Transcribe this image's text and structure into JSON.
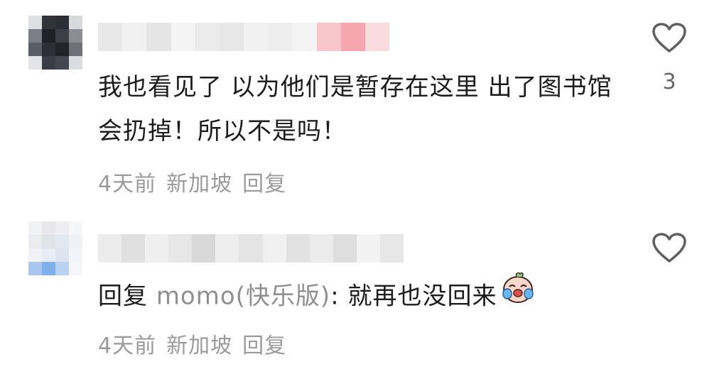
{
  "comments": [
    {
      "text": "我也看见了 以为他们是暂存在这里 出了图书馆会扔掉！所以不是吗！",
      "time": "4天前",
      "location": "新加坡",
      "reply_label": "回复",
      "like_count": "3",
      "avatar_colors": [
        "#dfe0e3",
        "#30333a",
        "#2a2d34",
        "#d9dadd",
        "#7a7d85",
        "#1e2128",
        "#3b3f48",
        "#8b8e95",
        "#5a5d66",
        "#2d3038",
        "#20232a",
        "#6e7179",
        "#e4e5e8",
        "#3a3d45",
        "#44474f",
        "#dcdde0"
      ],
      "username_colors": [
        "#e8e8e8",
        "#f1f1f1",
        "#e5e5e5",
        "#f4f4f4",
        "#ebebeb",
        "#e7e7e7",
        "#f0f0f0",
        "#ededed",
        "#f3f3f3",
        "#f7c6cb",
        "#f5a5ae",
        "#f9dadd"
      ]
    },
    {
      "reply_prefix": "回复",
      "reply_to": "momo(快乐版)",
      "text": ": 就再也没回来",
      "emoji": "crying-face",
      "time": "4天前",
      "location": "新加坡",
      "reply_label": "回复",
      "like_count": "",
      "avatar_colors": [
        "#f1f2f4",
        "#e6e8ec",
        "#eceef1",
        "#f5f6f8",
        "#e9ebef",
        "#dfe3ea",
        "#e3e7ee",
        "#eff1f4",
        "#f0f2f5",
        "#e8ecf3",
        "#dde4ef",
        "#f2f4f7",
        "#a9c6ef",
        "#7fb0ec",
        "#b9d2f3",
        "#f4f6f9"
      ],
      "username_colors": [
        "#ececec",
        "#e0e0e0",
        "#efefef",
        "#e6e6e6",
        "#d9d9d9",
        "#eeeeee",
        "#e4e4e4",
        "#f0f0f0",
        "#e2e2e2",
        "#ebebeb",
        "#dedede",
        "#f2f2f2",
        "#e7e7e7"
      ]
    }
  ],
  "icons": {
    "like": "heart-outline-icon",
    "emoji": "crying-face-emoji"
  },
  "colors": {
    "text": "#1c1c1c",
    "meta": "#9a9a9a",
    "reply_user": "#8f8f8f",
    "icon": "#5f5f5f"
  }
}
